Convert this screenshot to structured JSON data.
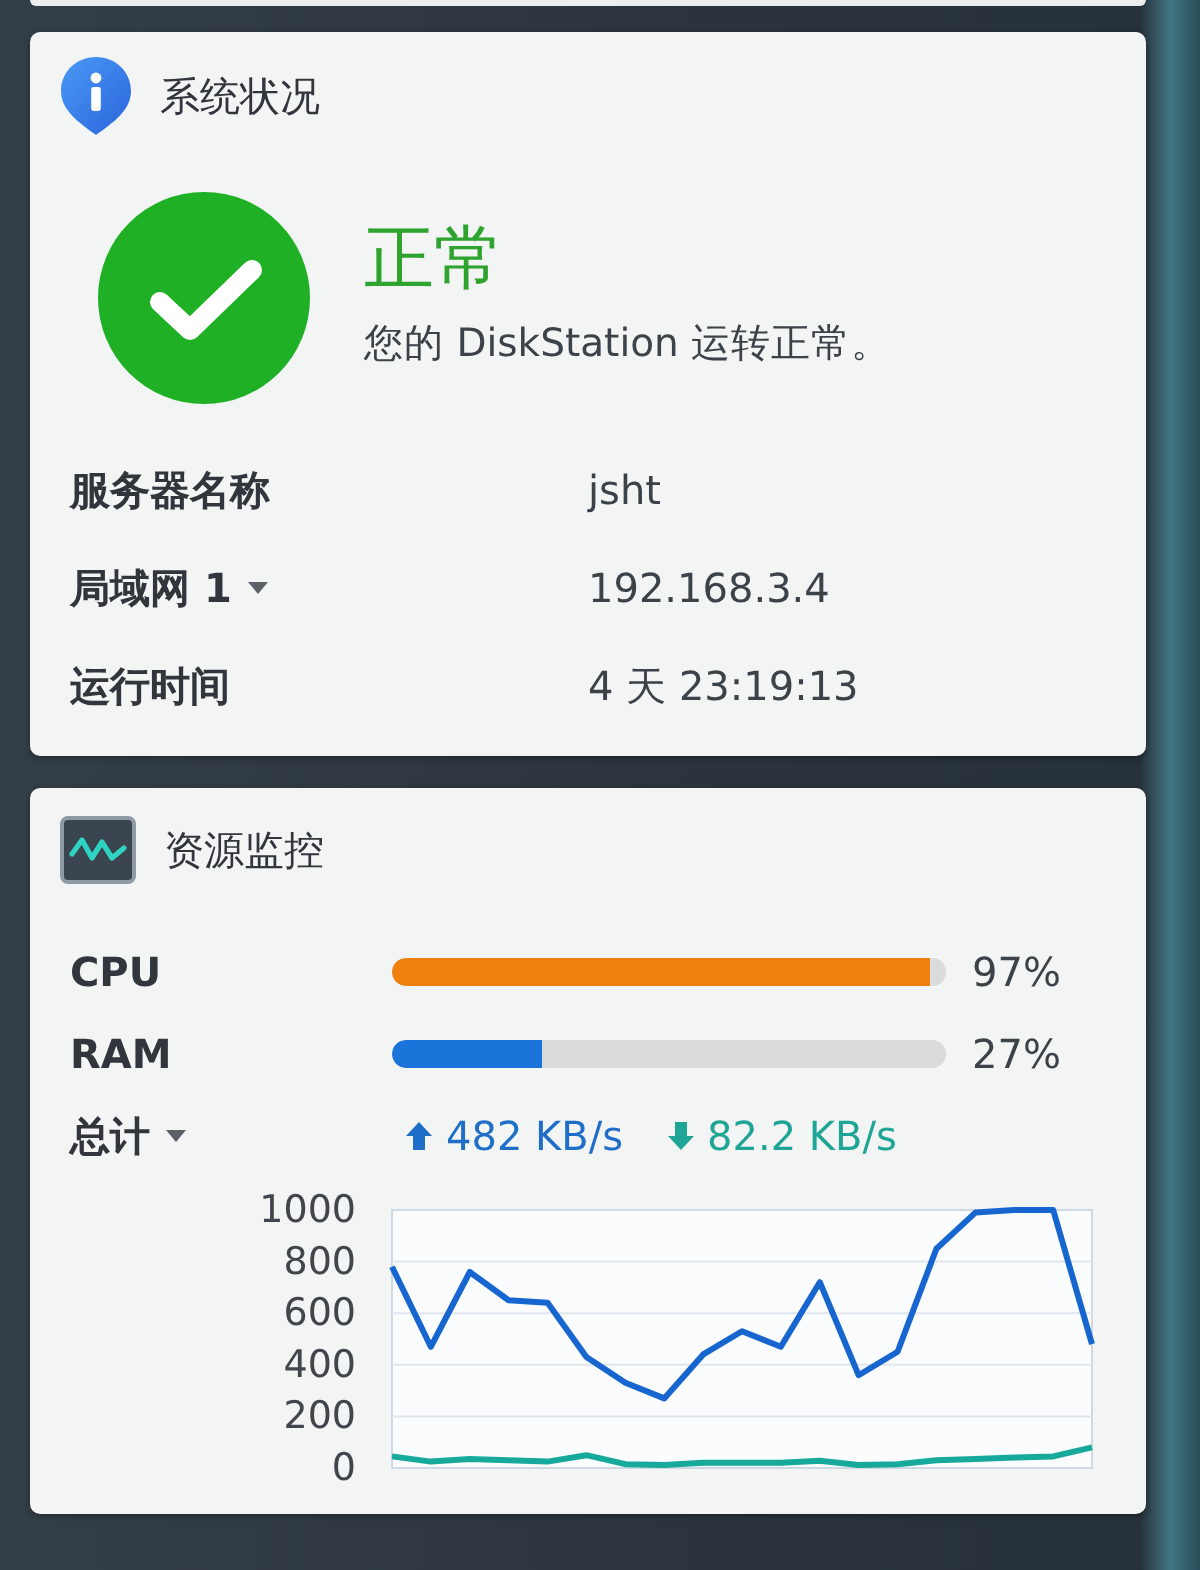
{
  "system_status": {
    "title": "系统状况",
    "status": {
      "kind": "ok",
      "label": "正常",
      "message": "您的 DiskStation 运转正常。"
    },
    "rows": [
      {
        "label": "服务器名称",
        "value": "jsht",
        "has_menu": false
      },
      {
        "label": "局域网 1",
        "value": "192.168.3.4",
        "has_menu": true
      },
      {
        "label": "运行时间",
        "value": "4 天 23:19:13",
        "has_menu": false
      }
    ]
  },
  "resource_monitor": {
    "title": "资源监控",
    "meters": [
      {
        "label": "CPU",
        "level": 0.97,
        "reading": "97%",
        "color": "#f0810f"
      },
      {
        "label": "RAM",
        "level": 0.27,
        "reading": "27%",
        "color": "#1a74d9"
      }
    ],
    "network": {
      "label": "总计",
      "has_menu": true,
      "items": [
        {
          "kind": "upload",
          "value": "482 KB/s"
        },
        {
          "kind": "download",
          "value": "82.2 KB/s"
        }
      ]
    },
    "chart_data": {
      "type": "line",
      "grid": true,
      "ylim": [
        0,
        1000
      ],
      "yticks": [
        0,
        200,
        400,
        600,
        800,
        1000
      ],
      "series": [
        {
          "color": "#1766d0",
          "values": [
            780,
            470,
            760,
            650,
            640,
            430,
            330,
            270,
            440,
            530,
            470,
            720,
            360,
            450,
            850,
            990,
            1000,
            1000,
            480
          ]
        },
        {
          "color": "#17a99b",
          "values": [
            45,
            25,
            35,
            30,
            25,
            50,
            15,
            12,
            20,
            20,
            20,
            28,
            12,
            15,
            30,
            35,
            40,
            45,
            80
          ]
        }
      ]
    }
  }
}
